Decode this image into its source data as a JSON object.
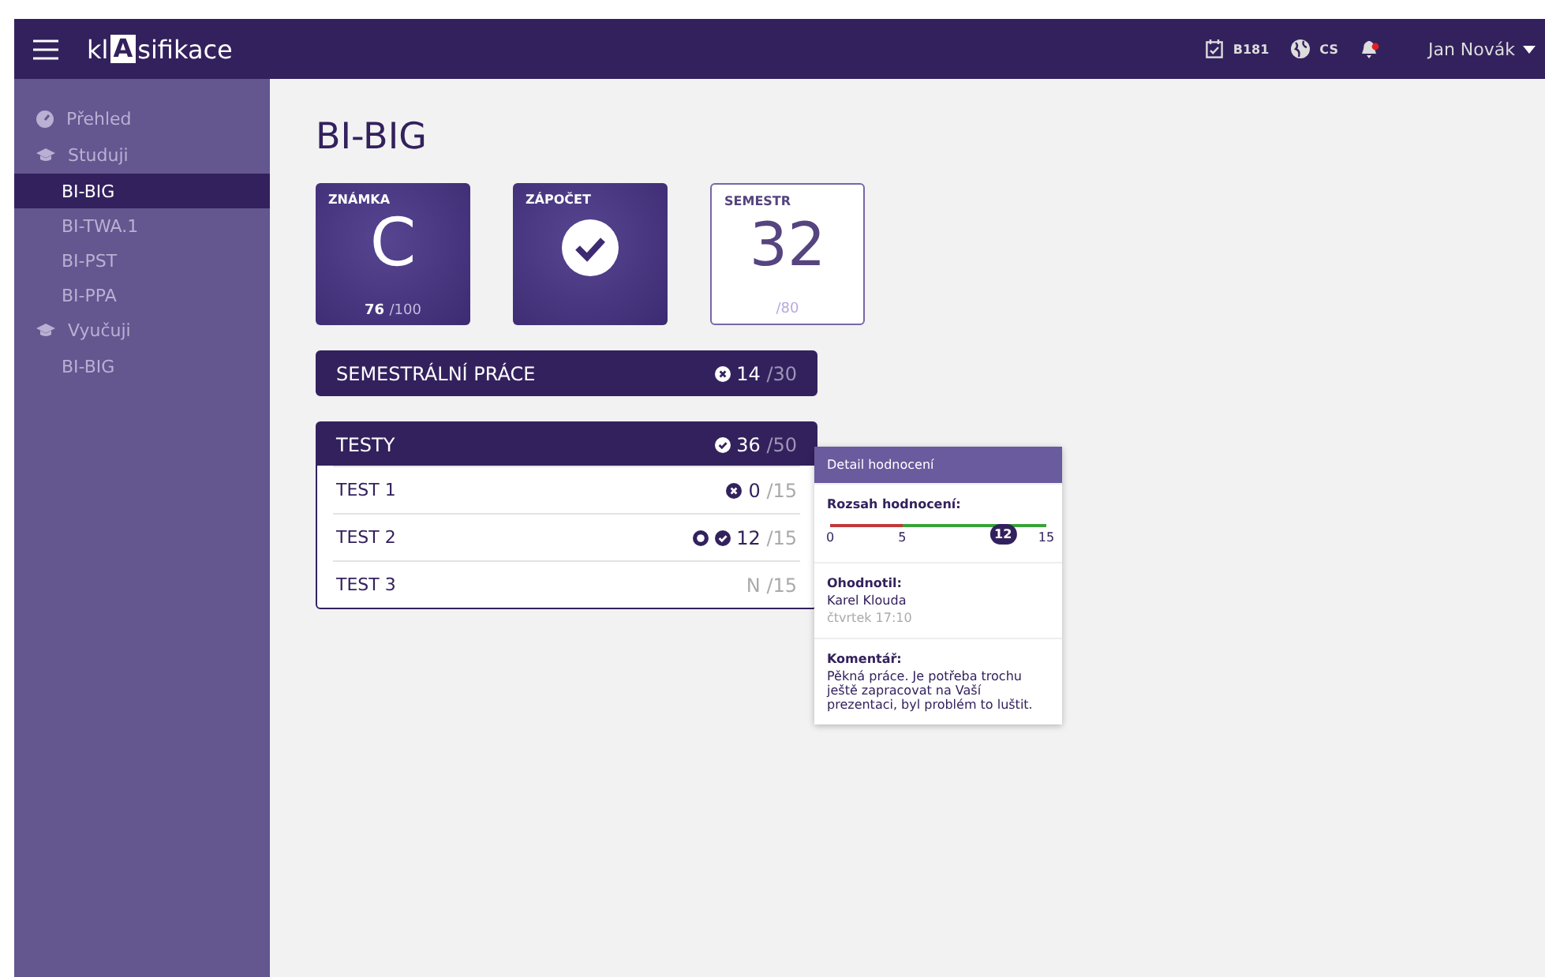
{
  "topbar": {
    "logo_before": "kl",
    "logo_mark": "A",
    "logo_after": "sifikace",
    "semester": "B181",
    "language": "CS",
    "notification": true,
    "user": "Jan Novák"
  },
  "sidebar": {
    "sections": [
      {
        "label": "Přehled"
      },
      {
        "label": "Studuji",
        "items": [
          {
            "label": "BI-BIG",
            "selected": true
          },
          {
            "label": "BI-TWA.1",
            "selected": false
          },
          {
            "label": "BI-PST",
            "selected": false
          },
          {
            "label": "BI-PPA",
            "selected": false
          }
        ]
      },
      {
        "label": "Vyučuji",
        "items": [
          {
            "label": "BI-BIG",
            "selected": false
          }
        ]
      }
    ]
  },
  "page": {
    "title": "BI-BIG",
    "cards": [
      {
        "kind": "grade",
        "label": "ZNÁMKA",
        "value": "C",
        "score": "76",
        "max": "/100"
      },
      {
        "kind": "check",
        "label": "ZÁPOČET",
        "passed": true
      },
      {
        "kind": "number",
        "label": "SEMESTR",
        "value": "32",
        "max": "/80"
      }
    ],
    "groups": [
      {
        "title": "SEMESTRÁLNÍ PRÁCE",
        "kind": "fail",
        "score": "14",
        "max": "/30"
      },
      {
        "title": "TESTY",
        "kind": "pass",
        "score": "36",
        "max": "/50",
        "rows": [
          {
            "name": "TEST 1",
            "comment": false,
            "kind": "fail",
            "score": "0",
            "max": "/15"
          },
          {
            "name": "TEST 2",
            "comment": true,
            "kind": "pass",
            "score": "12",
            "max": "/15",
            "detail": {
              "title": "Detail hodnocení",
              "range_label": "Rozsah hodnocení:",
              "range_ticks": [
                "0",
                "5",
                "15"
              ],
              "value": "12",
              "level": 0.8,
              "grader_label": "Ohodnotil:",
              "grader": "Karel Klouda",
              "time": "čtvrtek 17:10",
              "comment_label": "Komentář:",
              "comment": "Pěkná práce. Je potřeba trochu ještě zapracovat na Vaší prezentaci, byl problém to luštit."
            }
          },
          {
            "name": "TEST 3",
            "comment": false,
            "kind": "none",
            "score": "N",
            "max": "/15"
          }
        ]
      }
    ]
  }
}
